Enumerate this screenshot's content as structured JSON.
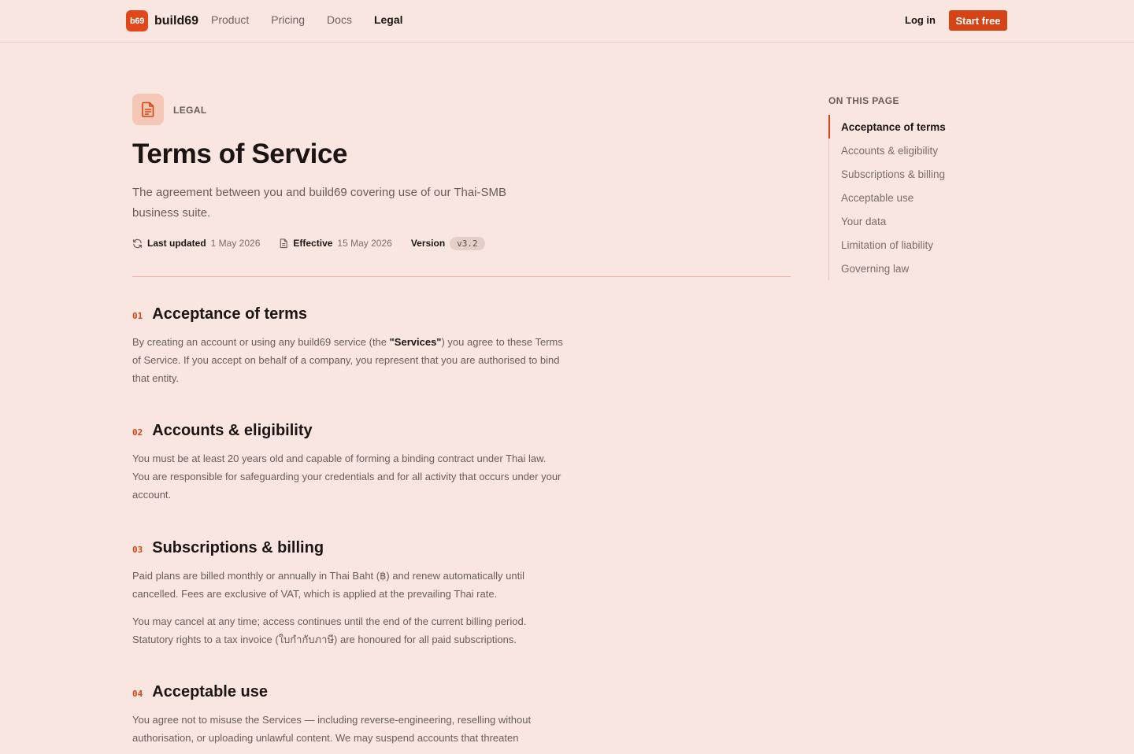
{
  "header": {
    "logo_mark": "b69",
    "brand": "build69",
    "nav": [
      "Product",
      "Pricing",
      "Docs",
      "Legal"
    ],
    "active_nav": "Legal",
    "login": "Log in",
    "cta": "Start free"
  },
  "hero": {
    "eyebrow": "LEGAL",
    "icon": "document-icon",
    "title": "Terms of Service",
    "subtitle": "The agreement between you and build69 covering use of our Thai-SMB business suite.",
    "meta": {
      "updated_label": "Last updated",
      "updated_value": "1 May 2026",
      "effective_label": "Effective",
      "effective_value": "15 May 2026",
      "version_label": "Version",
      "version_value": "v3.2"
    }
  },
  "sections": [
    {
      "num": "01",
      "title": "Acceptance of terms",
      "p1_before": "By creating an account or using any build69 service (the ",
      "p1_bold": "\"Services\"",
      "p1_after": ") you agree to these Terms of Service. If you accept on behalf of a company, you represent that you are authorised to bind that entity."
    },
    {
      "num": "02",
      "title": "Accounts & eligibility",
      "p1": "You must be at least 20 years old and capable of forming a binding contract under Thai law. You are responsible for safeguarding your credentials and for all activity that occurs under your account."
    },
    {
      "num": "03",
      "title": "Subscriptions & billing",
      "p1": "Paid plans are billed monthly or annually in Thai Baht (฿) and renew automatically until cancelled. Fees are exclusive of VAT, which is applied at the prevailing Thai rate.",
      "p2": "You may cancel at any time; access continues until the end of the current billing period. Statutory rights to a tax invoice (ใบกำกับภาษี) are honoured for all paid subscriptions."
    },
    {
      "num": "04",
      "title": "Acceptable use",
      "p1": "You agree not to misuse the Services — including reverse-engineering, reselling without authorisation, or uploading unlawful content. We may suspend accounts that threaten"
    }
  ],
  "toc": {
    "title": "ON THIS PAGE",
    "items": [
      "Acceptance of terms",
      "Accounts & eligibility",
      "Subscriptions & billing",
      "Acceptable use",
      "Your data",
      "Limitation of liability",
      "Governing law"
    ],
    "active": 0
  },
  "colors": {
    "background": "#f9e6e0",
    "accent": "#d44414",
    "text": "#1b1413",
    "muted": "#6a5c57"
  }
}
